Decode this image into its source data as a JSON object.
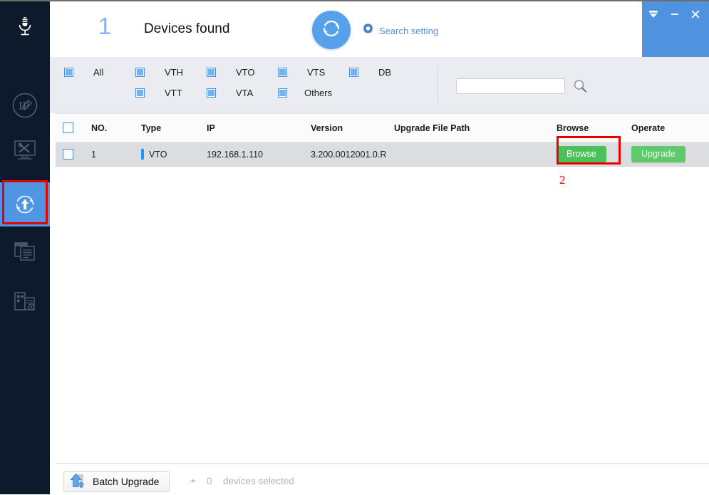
{
  "window": {
    "controls": [
      {
        "name": "tray-icon",
        "label": "Minimize to tray"
      },
      {
        "name": "minimize-icon",
        "label": "Minimize"
      },
      {
        "name": "close-icon",
        "label": "Close"
      }
    ],
    "accent_blue": "#4f92de"
  },
  "sidebar": {
    "background": "#0c1a2b",
    "active_background": "#4f96e3",
    "items": [
      {
        "icon": "microphone-icon",
        "name": "sidebar-item-microphone",
        "active": false
      },
      {
        "icon": "ip-modify-icon",
        "name": "sidebar-item-ip-modify",
        "active": false
      },
      {
        "icon": "device-tools-icon",
        "name": "sidebar-item-device-tools",
        "active": false
      },
      {
        "icon": "upgrade-icon",
        "name": "sidebar-item-upgrade",
        "active": true
      },
      {
        "icon": "config-files-icon",
        "name": "sidebar-item-config-files",
        "active": false
      },
      {
        "icon": "system-settings-icon",
        "name": "sidebar-item-system-settings",
        "active": false
      }
    ]
  },
  "annotations": {
    "sidebar_step": "1",
    "browse_step": "2",
    "color": "#e60000"
  },
  "header": {
    "device_count": "1",
    "devices_found_label": "Devices found",
    "refresh_icon": "refresh-icon",
    "search_setting_label": "Search setting",
    "search_setting_icon": "gear-icon"
  },
  "filters": {
    "row1": [
      {
        "label": "All",
        "checked": true,
        "name": "filter-checkbox-all"
      },
      {
        "label": "VTH",
        "checked": true,
        "name": "filter-checkbox-vth"
      },
      {
        "label": "VTO",
        "checked": true,
        "name": "filter-checkbox-vto"
      },
      {
        "label": "VTS",
        "checked": true,
        "name": "filter-checkbox-vts"
      },
      {
        "label": "DB",
        "checked": true,
        "name": "filter-checkbox-db"
      }
    ],
    "row2": [
      {
        "label": "VTT",
        "checked": true,
        "name": "filter-checkbox-vtt"
      },
      {
        "label": "VTA",
        "checked": true,
        "name": "filter-checkbox-vta"
      },
      {
        "label": "Others",
        "checked": true,
        "name": "filter-checkbox-others"
      }
    ],
    "search": {
      "value": "",
      "placeholder": "",
      "icon": "search-icon"
    }
  },
  "table": {
    "columns": {
      "no": "NO.",
      "type": "Type",
      "ip": "IP",
      "version": "Version",
      "upgrade_file_path": "Upgrade File Path",
      "browse": "Browse",
      "operate": "Operate"
    },
    "rows": [
      {
        "checked": false,
        "no": "1",
        "type": "VTO",
        "type_color": "#2196f3",
        "ip": "192.168.1.110",
        "version": "3.200.0012001.0.R",
        "upgrade_file_path": "",
        "browse_label": "Browse",
        "operate_label": "Upgrade"
      }
    ],
    "button_color": "#4cc15a"
  },
  "footer": {
    "batch_upgrade_label": "Batch Upgrade",
    "batch_upgrade_icon": "upload-arrow-icon",
    "required_marker": "*",
    "selected_count": "0",
    "selected_text": "devices selected"
  }
}
